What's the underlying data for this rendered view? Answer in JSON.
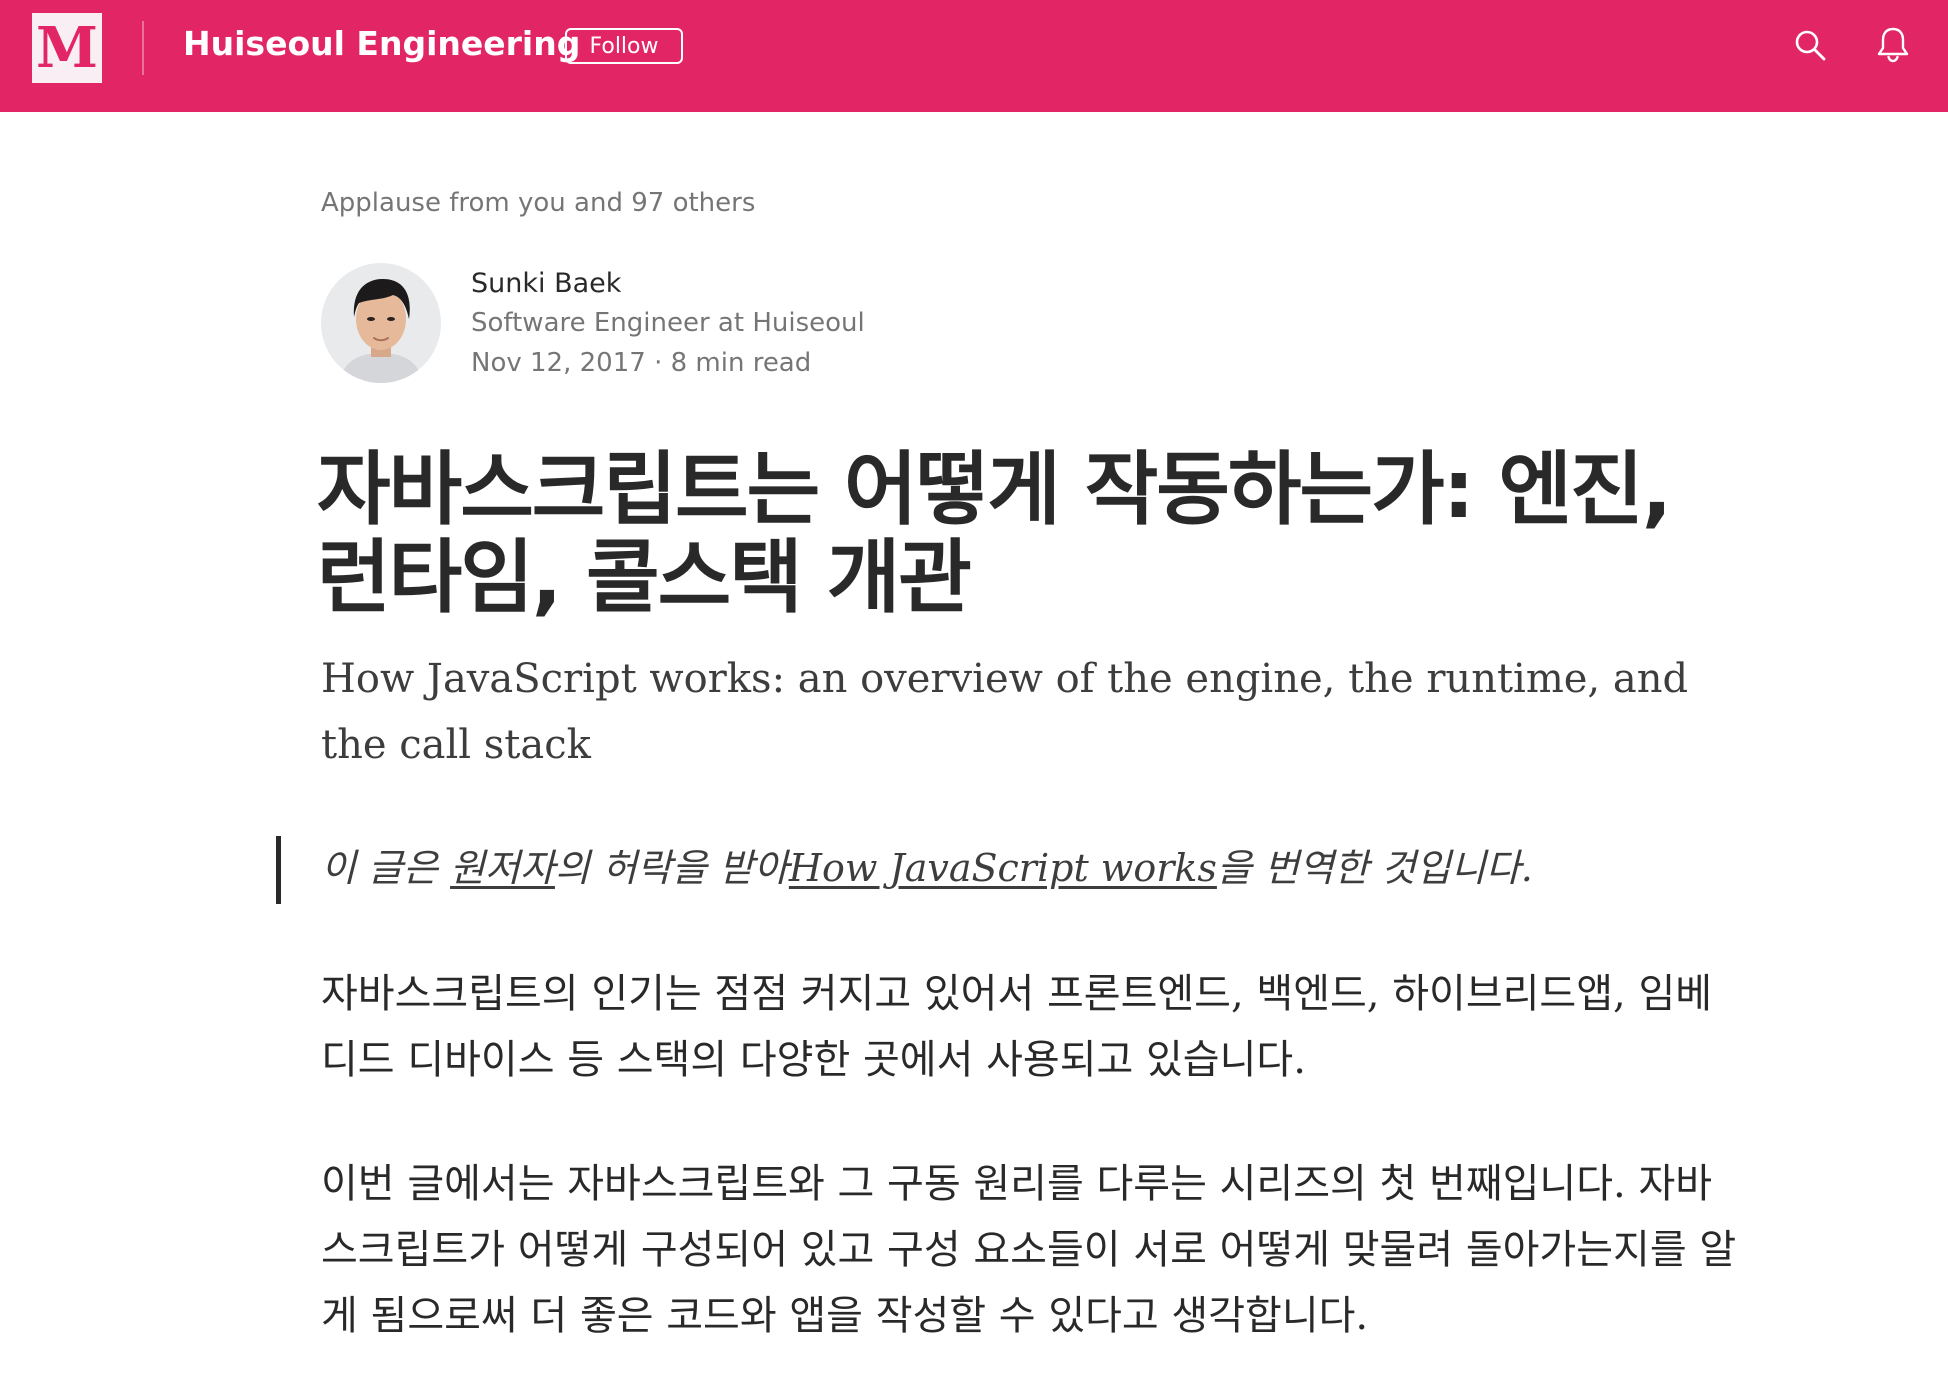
{
  "header": {
    "logo_letter": "M",
    "publication_name": "Huiseoul Engineering",
    "follow_label": "Follow",
    "brand_color": "#e22565"
  },
  "icons": {
    "search": "search-icon",
    "notifications": "bell-icon"
  },
  "applause_text": "Applause from you and 97 others",
  "author": {
    "name": "Sunki Baek",
    "bio": "Software Engineer at Huiseoul",
    "date": "Nov 12, 2017",
    "separator": "·",
    "read_time": "8 min read"
  },
  "article": {
    "title": "자바스크립트는 어떻게 작동하는가: 엔진, 런타임, 콜스택 개관",
    "subtitle": "How JavaScript works: an overview of the engine, the runtime, and the call stack",
    "quote": {
      "part1": "이 글은 ",
      "link1": "원저자",
      "part2": "의 허락을 받아",
      "link2": "How JavaScript works",
      "part3": "을 번역한 것입니다."
    },
    "paragraphs": [
      "자바스크립트의 인기는 점점 커지고 있어서 프론트엔드, 백엔드, 하이브리드앱, 임베디드 디바이스 등 스택의 다양한 곳에서 사용되고 있습니다.",
      "이번 글에서는 자바스크립트와 그 구동 원리를 다루는 시리즈의 첫 번째입니다. 자바스크립트가 어떻게 구성되어 있고 구성 요소들이 서로 어떻게 맞물려 돌아가는지를 알게 됨으로써 더 좋은 코드와 앱을 작성할 수 있다고 생각합니다."
    ]
  }
}
